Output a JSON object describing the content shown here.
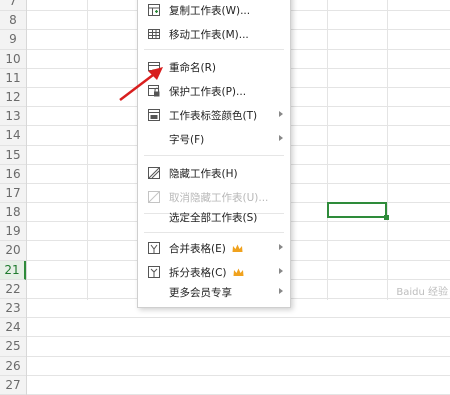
{
  "row_numbers": [
    "7",
    "8",
    "9",
    "10",
    "11",
    "12",
    "13",
    "14",
    "15",
    "16",
    "17",
    "18",
    "19",
    "20",
    "21",
    "22",
    "23",
    "24",
    "25",
    "26",
    "27"
  ],
  "active_row": "21",
  "menu": {
    "items": [
      {
        "label": "复制工作表(W)...",
        "icon": "copy-sheet-icon"
      },
      {
        "label": "移动工作表(M)...",
        "icon": "move-sheet-icon"
      },
      {
        "label": "重命名(R)",
        "icon": "rename-icon"
      },
      {
        "label": "保护工作表(P)...",
        "icon": "protect-sheet-icon"
      },
      {
        "label": "工作表标签颜色(T)",
        "icon": "tab-color-icon"
      },
      {
        "label": "字号(F)"
      },
      {
        "label": "隐藏工作表(H)",
        "icon": "hide-sheet-icon"
      },
      {
        "label": "取消隐藏工作表(U)...",
        "icon": "unhide-sheet-icon"
      },
      {
        "label": "选定全部工作表(S)"
      },
      {
        "label": "合并表格(E)",
        "icon": "merge-tables-icon"
      },
      {
        "label": "拆分表格(C)",
        "icon": "split-table-icon"
      },
      {
        "label": "更多会员专享"
      }
    ]
  },
  "colors": {
    "selection": "#2e8b3a",
    "annotation_arrow": "#d81e1e",
    "crown": "#f0a21e"
  },
  "watermark": "Baidu 经验"
}
